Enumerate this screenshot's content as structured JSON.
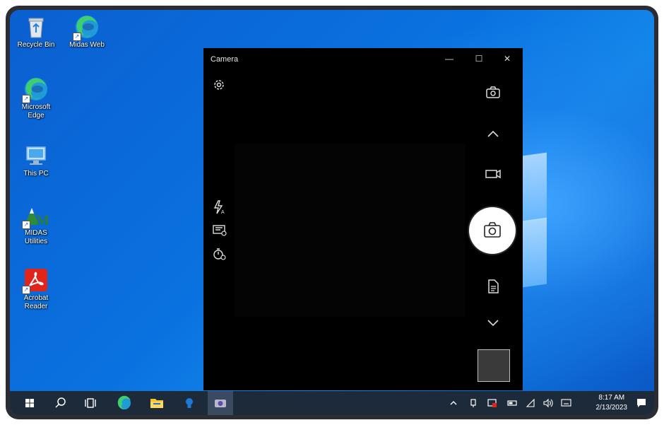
{
  "desktop": {
    "icons": [
      {
        "label": "Recycle Bin",
        "icon": "recycle-bin-icon"
      },
      {
        "label": "Midas Web",
        "icon": "edge-icon"
      },
      {
        "label": "Microsoft\nEdge",
        "icon": "edge-icon"
      },
      {
        "label": "This PC",
        "icon": "computer-icon"
      },
      {
        "label": "MIDAS\nUtilities",
        "icon": "midas-icon"
      },
      {
        "label": "Acrobat\nReader",
        "icon": "acrobat-icon"
      }
    ]
  },
  "camera_window": {
    "title": "Camera",
    "controls": [
      "minimize-icon",
      "maximize-icon",
      "close-icon"
    ],
    "left_tools": [
      "settings-icon",
      "flash-icon",
      "qr-code-icon",
      "timer-icon"
    ],
    "right_tools": [
      "switch-camera-icon",
      "chevron-up-icon",
      "video-mode-icon",
      "photo-shutter-icon",
      "document-mode-icon",
      "chevron-down-icon"
    ]
  },
  "taskbar": {
    "items": [
      "windows-start-icon",
      "search-icon",
      "task-view-icon",
      "edge-icon",
      "file-explorer-icon",
      "bulb-app-icon",
      "camera-app-icon"
    ],
    "active_item": "camera-app-icon",
    "clock": {
      "time": "8:17 AM",
      "date": "2/13/2023"
    }
  },
  "colors": {
    "desktop_blue": "#0a72e0",
    "taskbar": "#1d2a3a",
    "camera_bg": "#000000",
    "shutter": "#ffffff"
  }
}
